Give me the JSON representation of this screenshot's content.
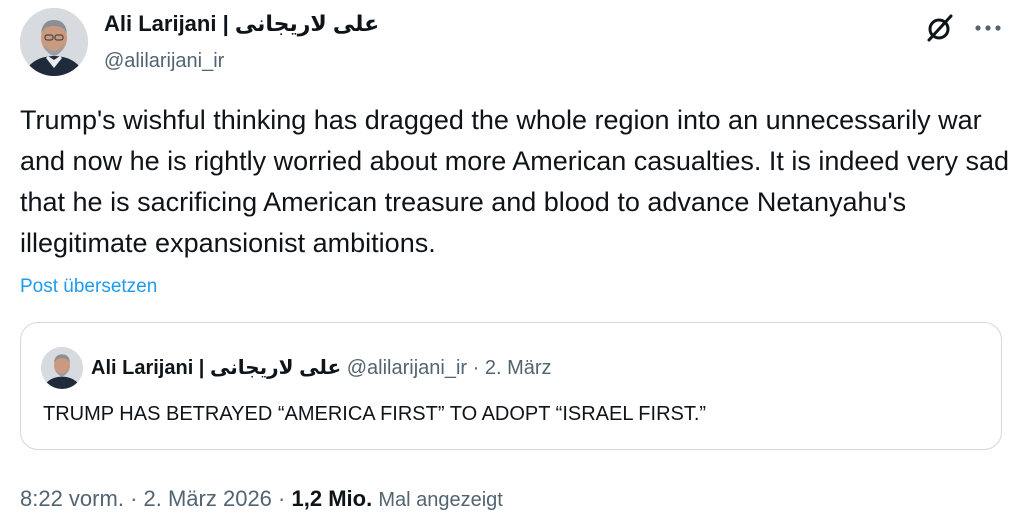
{
  "author": {
    "display_name": "Ali Larijani | علی لاریجانی",
    "handle": "@alilarijani_ir"
  },
  "post": {
    "text": "Trump's wishful thinking has dragged the whole region into an unnecessarily war and now he is rightly worried about more American casualties. It is indeed very sad that he is sacrificing American treasure and blood to advance Netanyahu's illegitimate expansionist ambitions.",
    "translate_label": "Post übersetzen"
  },
  "quoted_post": {
    "display_name": "Ali Larijani | علی لاریجانی",
    "handle": "@alilarijani_ir",
    "separator": "·",
    "date": "2. März",
    "text": "TRUMP HAS BETRAYED “AMERICA FIRST” TO ADOPT “ISRAEL FIRST.”"
  },
  "meta": {
    "time": "8:22 vorm.",
    "separator": "·",
    "date": "2. März 2026",
    "views_count": "1,2 Mio.",
    "views_label": "Mal angezeigt"
  },
  "icons": {
    "grok": "grok-icon",
    "more": "more-icon",
    "avatar": "avatar"
  }
}
